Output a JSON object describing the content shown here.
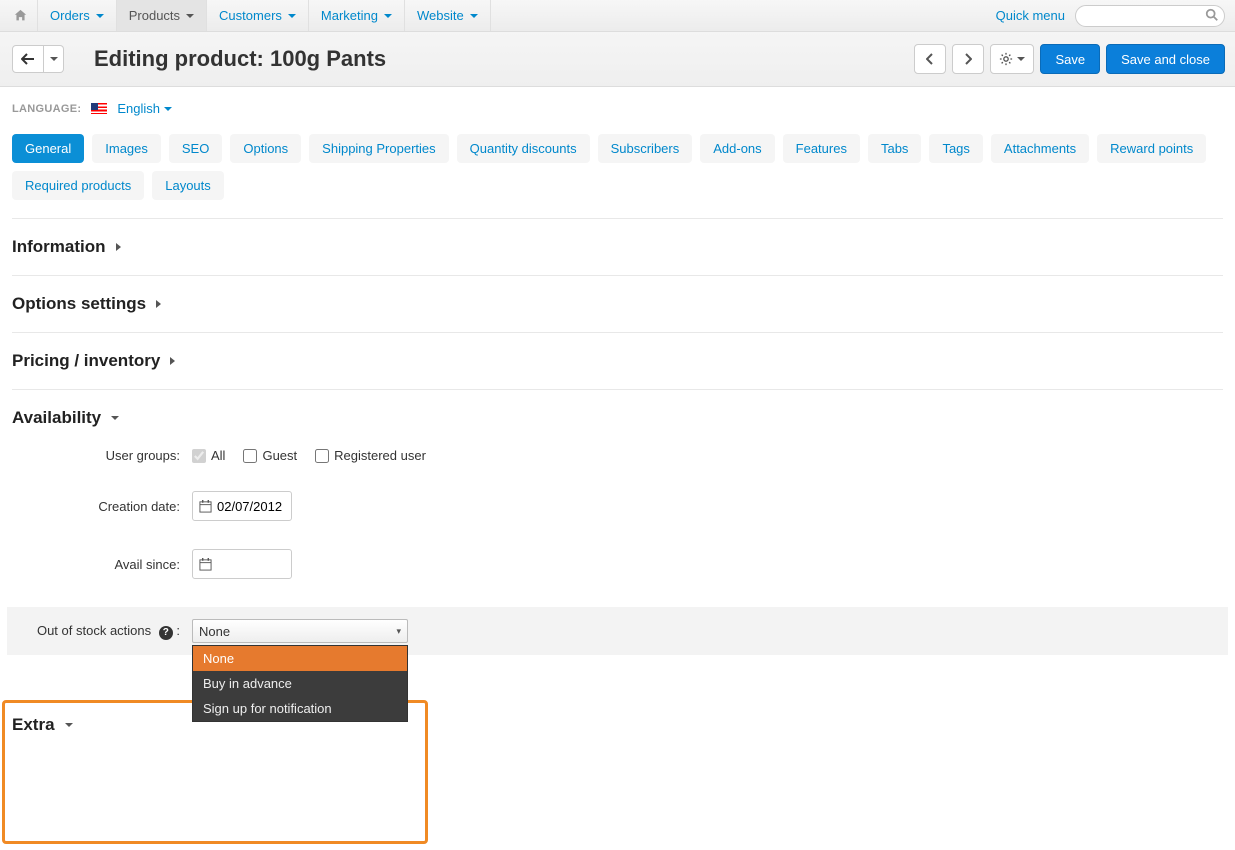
{
  "topnav": {
    "items": [
      "Orders",
      "Products",
      "Customers",
      "Marketing",
      "Website"
    ],
    "active_index": 1,
    "quick_menu": "Quick menu"
  },
  "header": {
    "title": "Editing product: 100g Pants",
    "save": "Save",
    "save_close": "Save and close"
  },
  "language": {
    "label": "Language:",
    "value": "English"
  },
  "tabs": {
    "row1": [
      "General",
      "Images",
      "SEO",
      "Options",
      "Shipping Properties",
      "Quantity discounts",
      "Subscribers",
      "Add-ons",
      "Features",
      "Tabs",
      "Tags",
      "Attachments",
      "Reward points"
    ],
    "row2": [
      "Required products",
      "Layouts"
    ],
    "active": "General"
  },
  "sections": {
    "information": "Information",
    "options_settings": "Options settings",
    "pricing": "Pricing / inventory",
    "availability": "Availability",
    "extra": "Extra"
  },
  "availability": {
    "user_groups_label": "User groups:",
    "groups": {
      "all": "All",
      "guest": "Guest",
      "registered": "Registered user"
    },
    "creation_date_label": "Creation date:",
    "creation_date": "02/07/2012",
    "avail_since_label": "Avail since:",
    "avail_since": "",
    "out_of_stock_label": "Out of stock actions",
    "out_of_stock_value": "None",
    "out_of_stock_options": [
      "None",
      "Buy in advance",
      "Sign up for notification"
    ]
  }
}
